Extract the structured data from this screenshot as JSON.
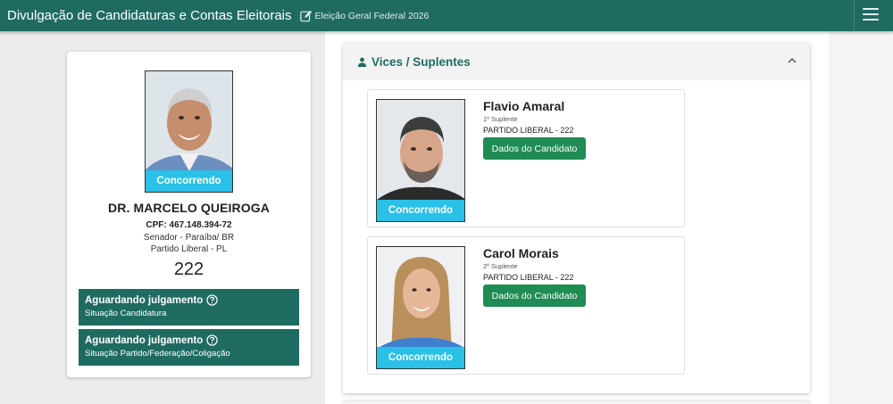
{
  "header": {
    "title": "Divulgação de Candidaturas e Contas Eleitorais",
    "election": "Eleição Geral Federal 2026",
    "menu_icon": "hamburger-icon"
  },
  "candidate": {
    "name": "DR. MARCELO QUEIROGA",
    "cpf": "CPF: 467.148.394-72",
    "office": "Senador - Paraíba/ BR",
    "party": "Partido Liberal - PL",
    "number": "222",
    "photo_status": "Concorrendo",
    "statuses": [
      {
        "title": "Aguardando julgamento",
        "subtitle": "Situação Candidatura"
      },
      {
        "title": "Aguardando julgamento",
        "subtitle": "Situação Partido/Federação/Coligação"
      }
    ]
  },
  "vices": {
    "title": "Vices / Suplentes",
    "items": [
      {
        "name": "Flavio Amaral",
        "role": "1º Suplente",
        "party": "PARTIDO LIBERAL - 222",
        "button": "Dados do Candidato",
        "photo_status": "Concorrendo"
      },
      {
        "name": "Carol Morais",
        "role": "2º Suplente",
        "party": "PARTIDO LIBERAL - 222",
        "button": "Dados do Candidato",
        "photo_status": "Concorrendo"
      }
    ]
  },
  "colors": {
    "primary": "#1f6b62",
    "status_tag": "#29c1e8",
    "button": "#1f8c54"
  }
}
